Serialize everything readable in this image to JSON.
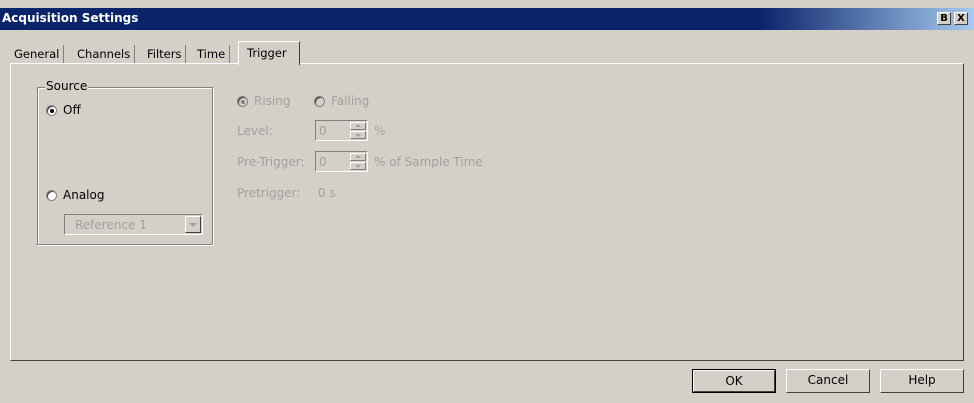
{
  "window": {
    "title": "Acquisition Settings",
    "restore_icon": "B",
    "close_icon": "X"
  },
  "tabs": [
    {
      "label": "General"
    },
    {
      "label": "Channels"
    },
    {
      "label": "Filters"
    },
    {
      "label": "Time"
    },
    {
      "label": "Trigger",
      "active": true
    }
  ],
  "source_group": {
    "title": "Source",
    "off_label": "Off",
    "analog_label": "Analog",
    "selected": "Off",
    "reference_value": "Reference 1"
  },
  "edge": {
    "rising_label": "Rising",
    "falling_label": "Falling",
    "selected": "Rising"
  },
  "level": {
    "label": "Level:",
    "value": "0",
    "unit": "%"
  },
  "pre_trigger": {
    "label": "Pre-Trigger:",
    "value": "0",
    "unit": "% of Sample Time"
  },
  "pretrigger_readout": {
    "label": "Pretrigger:",
    "value": "0 s"
  },
  "buttons": {
    "ok": "OK",
    "cancel": "Cancel",
    "help": "Help"
  },
  "colors": {
    "titlebar": "#0a246a",
    "face": "#d4d0c8",
    "disabled_text": "#a0a0a0"
  }
}
